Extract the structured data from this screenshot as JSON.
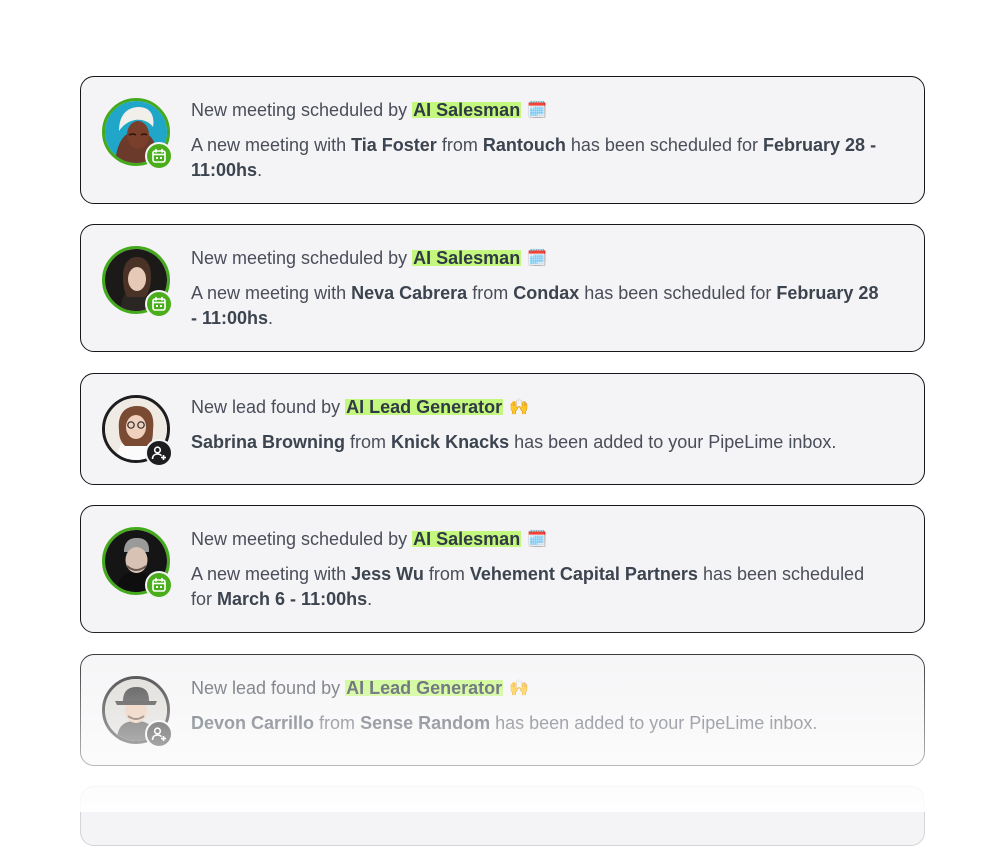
{
  "notifications": [
    {
      "type": "meeting",
      "headline_prefix": "New meeting scheduled by",
      "agent": "AI Salesman",
      "emoji": "🗓️",
      "text_1": "A new meeting with",
      "person": "Tia Foster",
      "text_2": "from",
      "company": "Rantouch",
      "text_3": "has been scheduled for",
      "datetime": "February 28 - 11:00hs",
      "text_4": "."
    },
    {
      "type": "meeting",
      "headline_prefix": "New meeting scheduled by",
      "agent": "AI Salesman",
      "emoji": "🗓️",
      "text_1": "A new meeting with",
      "person": "Neva Cabrera",
      "text_2": "from",
      "company": "Condax",
      "text_3": "has been scheduled for",
      "datetime": "February 28 - 11:00hs",
      "text_4": "."
    },
    {
      "type": "lead",
      "headline_prefix": "New lead found by",
      "agent": "AI Lead Generator",
      "emoji": "🙌",
      "person": "Sabrina Browning",
      "text_2": "from",
      "company": "Knick Knacks",
      "text_3": "has been added to your PipeLime inbox."
    },
    {
      "type": "meeting",
      "headline_prefix": "New meeting scheduled by",
      "agent": "AI Salesman",
      "emoji": "🗓️",
      "text_1": "A new meeting with",
      "person": "Jess Wu",
      "text_2": "from",
      "company": "Vehement Capital Partners",
      "text_3": "has been scheduled for",
      "datetime": "March 6 - 11:00hs",
      "text_4": "."
    },
    {
      "type": "lead",
      "headline_prefix": "New lead found by",
      "agent": "AI Lead Generator",
      "emoji": "🙌",
      "person": "Devon Carrillo",
      "text_2": "from",
      "company": "Sense Random",
      "text_3": "has been added to your PipeLime inbox."
    }
  ],
  "colors": {
    "meeting_badge": "#4aae1c",
    "lead_badge": "#1d1d1f",
    "agent_highlight": "#c4f77d",
    "card_bg": "#f4f3f5",
    "card_border": "#16171b"
  },
  "icons": {
    "meeting_badge": "calendar-icon",
    "lead_badge": "add-user-icon"
  }
}
